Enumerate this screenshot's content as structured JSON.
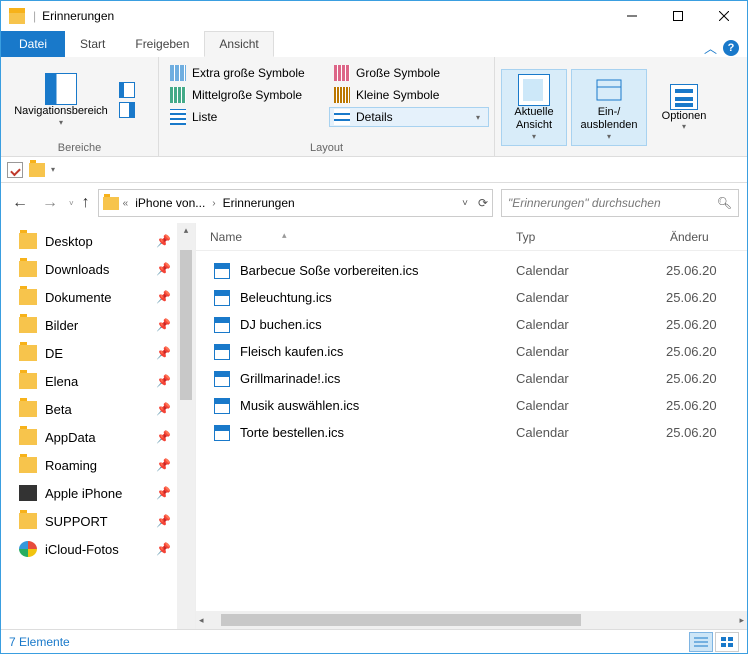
{
  "window": {
    "title": "Erinnerungen"
  },
  "tabs": {
    "file": "Datei",
    "start": "Start",
    "share": "Freigeben",
    "view": "Ansicht"
  },
  "ribbon": {
    "panes_label": "Bereiche",
    "layout_label": "Layout",
    "nav_pane": "Navigationsbereich",
    "layout_items": {
      "xl": "Extra große Symbole",
      "lg": "Große Symbole",
      "md": "Mittelgroße Symbole",
      "sm": "Kleine Symbole",
      "list": "Liste",
      "details": "Details"
    },
    "current_view": "Aktuelle Ansicht",
    "show_hide": "Ein-/ ausblenden",
    "options": "Optionen"
  },
  "breadcrumbs": {
    "seg1": "iPhone von...",
    "seg2": "Erinnerungen"
  },
  "search": {
    "placeholder": "\"Erinnerungen\" durchsuchen"
  },
  "sidebar": [
    {
      "label": "Desktop"
    },
    {
      "label": "Downloads"
    },
    {
      "label": "Dokumente"
    },
    {
      "label": "Bilder"
    },
    {
      "label": "DE"
    },
    {
      "label": "Elena"
    },
    {
      "label": "Beta"
    },
    {
      "label": "AppData"
    },
    {
      "label": "Roaming"
    },
    {
      "label": "Apple iPhone",
      "icon": "phone"
    },
    {
      "label": "SUPPORT"
    },
    {
      "label": "iCloud-Fotos",
      "icon": "cloud"
    }
  ],
  "columns": {
    "name": "Name",
    "type": "Typ",
    "modified": "Änderu"
  },
  "files": [
    {
      "name": "Barbecue Soße vorbereiten.ics",
      "type": "Calendar",
      "date": "25.06.20"
    },
    {
      "name": "Beleuchtung.ics",
      "type": "Calendar",
      "date": "25.06.20"
    },
    {
      "name": "DJ buchen.ics",
      "type": "Calendar",
      "date": "25.06.20"
    },
    {
      "name": "Fleisch kaufen.ics",
      "type": "Calendar",
      "date": "25.06.20"
    },
    {
      "name": "Grillmarinade!.ics",
      "type": "Calendar",
      "date": "25.06.20"
    },
    {
      "name": "Musik auswählen.ics",
      "type": "Calendar",
      "date": "25.06.20"
    },
    {
      "name": "Torte bestellen.ics",
      "type": "Calendar",
      "date": "25.06.20"
    }
  ],
  "status": {
    "count": "7 Elemente"
  }
}
